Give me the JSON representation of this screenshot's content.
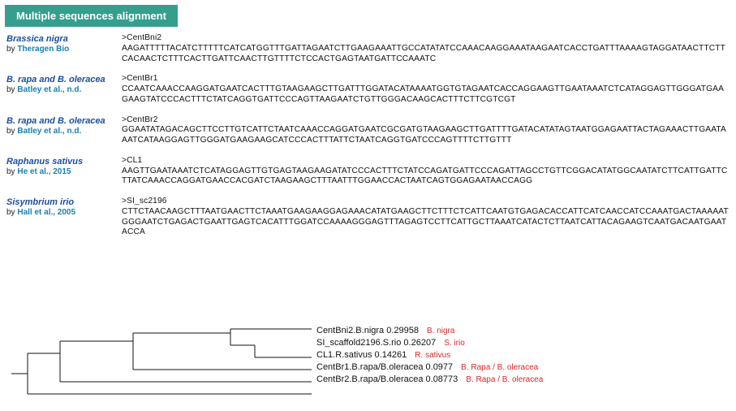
{
  "header": {
    "title": "Multiple sequences alignment"
  },
  "sequences": [
    {
      "species": "Brassica nigra",
      "by": "by ",
      "author": "Theragen Bio",
      "id": ">CentBni2",
      "seq": "AAGATTTTTACATCTTTTTCATCATGGTTTGATTAGAATCTTGAAGAAATTGCCATATATCCAAACAAGGAAATAAGAATCACCTGATTTAAAAGTAGGATAACTTCTTCACAACTCTTTCACTTGATTCAACTTGTTTTCTCCACTGAGTAATGATTCCAAATC"
    },
    {
      "species": "B. rapa and B. oleracea",
      "by": "by ",
      "author": "Batley et al., n.d.",
      "id": ">CentBr1",
      "seq": "CCAATCAAACCAAGGATGAATCACTTTGTAAGAAGCTTGATTTGGATACATAAAATGGTGTAGAATCACCAGGAAGTTGAATAAATCTCATAGGAGTTGGGATGAAGAAGTATCCCACTTTCTATCAGGTGATTCCCAGTTAAGAATCTGTTGGGACAAGCACTTTCTTCGTCGT"
    },
    {
      "species": "B. rapa and B. oleracea",
      "by": "by ",
      "author": "Batley et al., n.d.",
      "id": ">CentBr2",
      "seq": "GGAATATAGACAGCTTCCTTGTCATTCTAATCAAACCAGGATGAATCGCGATGTAAGAAGCTTGATTTTGATACATATAGTAATGGAGAATTACTAGAAACTTGAATAAATCATAAGGAGTTGGGATGAAGAAGCATCCCACTTTATTCTAATCAGGTGATCCCAGTTTTCTTGTTT"
    },
    {
      "species": "Raphanus sativus",
      "by": "by ",
      "author": "He et al., 2015",
      "id": ">CL1",
      "seq": "AAGTTGAATAAATCTCATAGGAGTTGTGAGTAAGAAGATATCCCACTTTCTATCCAGATGATTCCCAGATTAGCCTGTTCGGACATATGGCAATATCTTCATTGATTCTTATCAAACCAGGATGAACCACGATCTAAGAAGCTTTAATTTGGAACCACTAATCAGTGGAGAATAACCAGG"
    },
    {
      "species": "Sisymbrium irio",
      "by": "by ",
      "author": "Hall et al., 2005",
      "id": ">SI_sc2196",
      "seq": "CTTCTAACAAGCTTTAATGAACTTCTAAATGAAGAAGGAGAAACATATGAAGCTTCTTTCTCATTCAATGTGAGACACCATTCATCAACCATCCAAATGACTAAAAATGGGAATCTGAGACTGAATTGAGTCACATTTGGATCCAAAAGGGAGTTTAGAGTCCTTCATTGCTTAAATCATACTCTTAATCATTACAGAAGTCAATGACAATGAATACCA"
    }
  ],
  "tree": {
    "entries": [
      {
        "label": "CentBni2.B.nigra 0.29958",
        "species": "B. nigra"
      },
      {
        "label": "SI_scaffold2196.S.rio 0.26207",
        "species": "S. irio"
      },
      {
        "label": "CL1.R.sativus 0.14261",
        "species": "R. sativus"
      },
      {
        "label": "CentBr1.B.rapa/B.oleracea 0.0977",
        "species": "B. Rapa / B. oleracea"
      },
      {
        "label": "CentBr2.B.rapa/B.oleracea 0.08773",
        "species": "B. Rapa / B. oleracea"
      }
    ]
  }
}
